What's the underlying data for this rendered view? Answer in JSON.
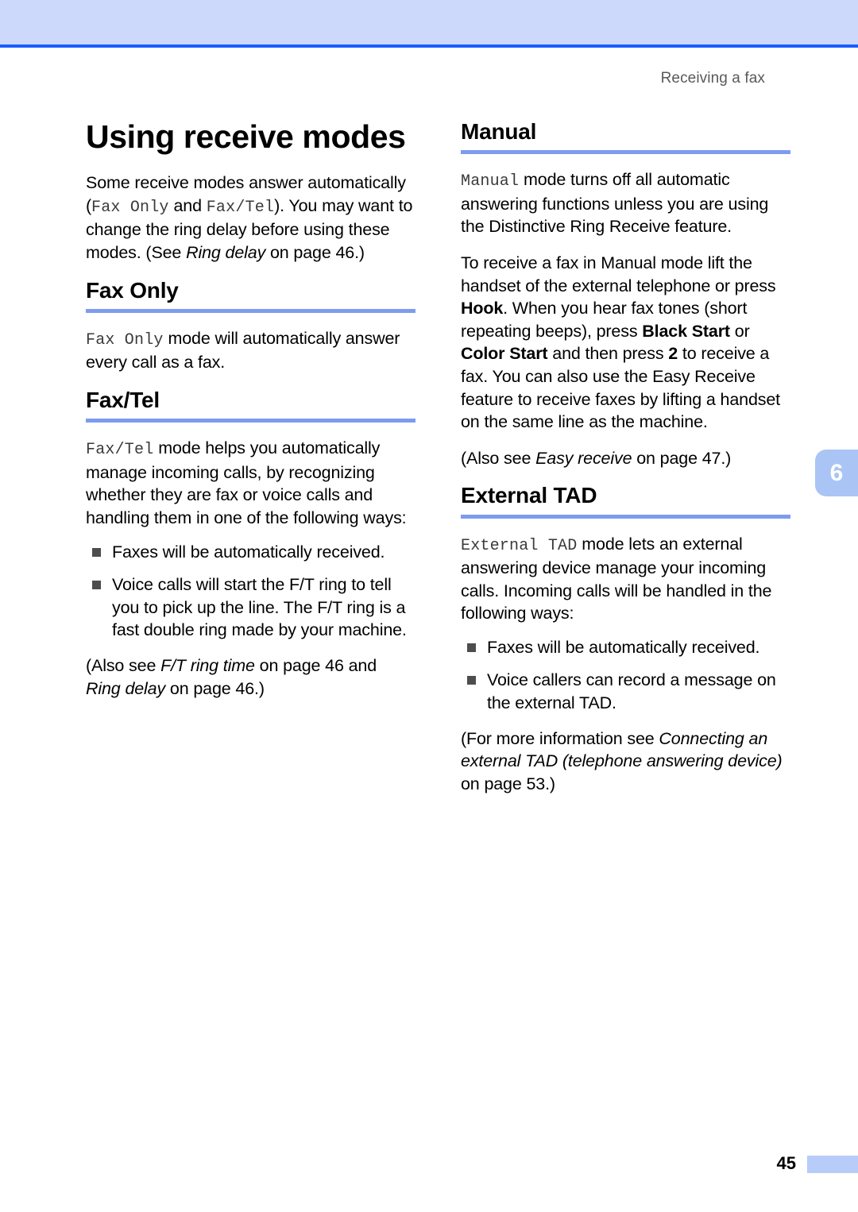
{
  "header": {
    "running_head": "Receiving a fax",
    "band_color": "#cdd9fb",
    "rule_color": "#1b5cff"
  },
  "chapter_tab": {
    "number": "6",
    "color": "#aac4f5"
  },
  "footer": {
    "page_number": "45",
    "bar_color": "#b8ccfa"
  },
  "accent": {
    "section_rule_color": "#7e9bf0"
  },
  "left_column": {
    "title": "Using receive modes",
    "intro": {
      "part1": "Some receive modes answer automatically (",
      "mode1": "Fax Only",
      "part2": " and ",
      "mode2": "Fax/Tel",
      "part3": "). You may want to change the ring delay before using these modes. (See ",
      "ref_italic": "Ring delay",
      "part4": " on page 46.)"
    },
    "fax_only": {
      "heading": "Fax Only",
      "body_mode": "Fax Only",
      "body_text": " mode will automatically answer every call as a fax."
    },
    "fax_tel": {
      "heading": "Fax/Tel",
      "body_mode": "Fax/Tel",
      "body_text": " mode helps you automatically manage incoming calls, by recognizing whether they are fax or voice calls and handling them in one of the following ways:",
      "bullets": [
        "Faxes will be automatically received.",
        "Voice calls will start the F/T ring to tell you to pick up the line. The F/T ring is a fast double ring made by your machine."
      ],
      "note": {
        "part1": "(Also see ",
        "ref1_italic": "F/T ring time",
        "part2": " on page 46 and ",
        "ref2_italic": "Ring delay",
        "part3": " on page 46.)"
      }
    }
  },
  "right_column": {
    "manual": {
      "heading": "Manual",
      "para1_mode": "Manual",
      "para1_text": " mode turns off all automatic answering functions unless you are using the Distinctive Ring Receive feature.",
      "para2": {
        "part1": "To receive a fax in Manual mode lift the handset of the external telephone or press ",
        "bold1": "Hook",
        "part2": ". When you hear fax tones (short repeating beeps), press ",
        "bold2": "Black Start",
        "part3": " or ",
        "bold3": "Color Start",
        "part4": " and then press ",
        "bold4": "2",
        "part5": " to receive a fax. You can also use the Easy Receive feature to receive faxes by lifting a handset on the same line as the machine."
      },
      "note": {
        "part1": "(Also see ",
        "ref_italic": "Easy receive",
        "part2": " on page 47.)"
      }
    },
    "external_tad": {
      "heading": "External TAD",
      "body_mode": "External TAD",
      "body_text": " mode lets an external answering device manage your incoming calls. Incoming calls will be handled in the following ways:",
      "bullets": [
        "Faxes will be automatically received.",
        "Voice callers can record a message on the external TAD."
      ],
      "note": {
        "part1": "(For more information see ",
        "ref_italic": "Connecting an external TAD (telephone answering device)",
        "part2": " on page 53.)"
      }
    }
  }
}
